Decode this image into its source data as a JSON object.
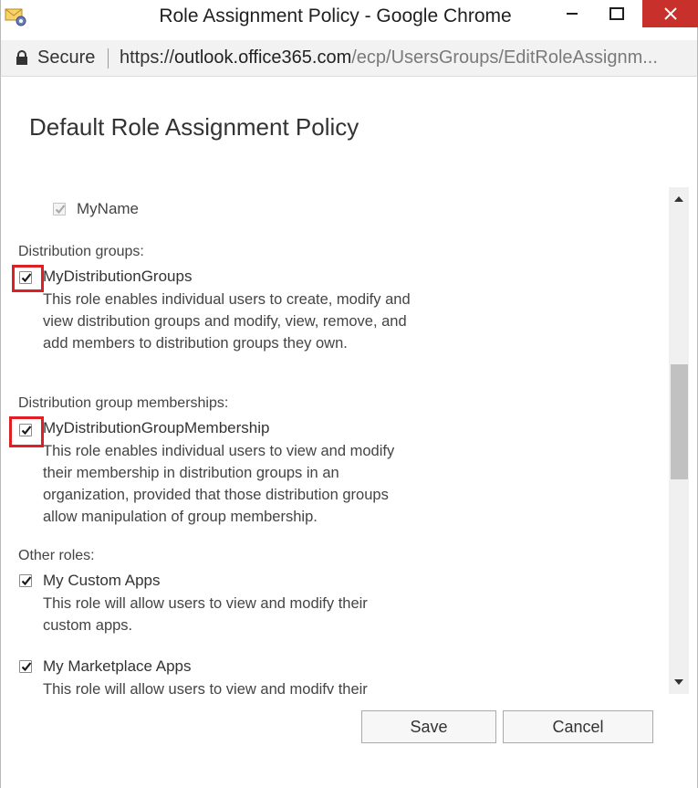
{
  "window": {
    "title": "Role Assignment Policy - Google Chrome",
    "minimize_glyph": "—",
    "maximize_glyph": "",
    "close_glyph": "✕"
  },
  "address_bar": {
    "secure_label": "Secure",
    "url_scheme": "https://",
    "url_host": "outlook.office365.com",
    "url_path": "/ecp/UsersGroups/EditRoleAssignm..."
  },
  "dialog": {
    "heading": "Default Role Assignment Policy"
  },
  "roles": {
    "myname": {
      "label": "MyName",
      "checked": true,
      "disabled": true
    },
    "distribution_groups": {
      "section_label": "Distribution groups:",
      "name": "MyDistributionGroups",
      "description": "This role enables individual users to create, modify and view distribution groups and modify, view, remove, and add members to distribution groups they own.",
      "checked": true,
      "highlighted": true
    },
    "distribution_group_memberships": {
      "section_label": "Distribution group memberships:",
      "name": "MyDistributionGroupMembership",
      "description": "This role enables individual users to view and modify their membership in distribution groups in an organization, provided that those distribution groups allow manipulation of group membership.",
      "checked": true,
      "highlighted": true
    },
    "other_roles": {
      "section_label": "Other roles:",
      "custom_apps": {
        "name": "My Custom Apps",
        "description": "This role will allow users to view and modify their custom apps.",
        "checked": true
      },
      "marketplace_apps": {
        "name": "My Marketplace Apps",
        "description": "This role will allow users to view and modify their",
        "checked": true
      }
    }
  },
  "buttons": {
    "save": "Save",
    "cancel": "Cancel"
  },
  "colors": {
    "highlight": "#e01e26",
    "close_button": "#c7302b"
  },
  "icons": [
    "app-icon",
    "lock-icon",
    "checkmark-icon",
    "scroll-up-arrow-icon",
    "scroll-down-arrow-icon"
  ]
}
